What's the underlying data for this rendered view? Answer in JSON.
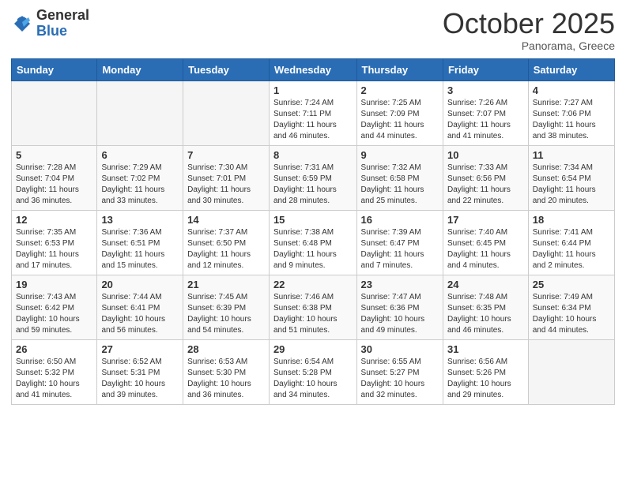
{
  "header": {
    "logo_general": "General",
    "logo_blue": "Blue",
    "month_title": "October 2025",
    "subtitle": "Panorama, Greece"
  },
  "days_of_week": [
    "Sunday",
    "Monday",
    "Tuesday",
    "Wednesday",
    "Thursday",
    "Friday",
    "Saturday"
  ],
  "weeks": [
    [
      {
        "day": "",
        "info": ""
      },
      {
        "day": "",
        "info": ""
      },
      {
        "day": "",
        "info": ""
      },
      {
        "day": "1",
        "info": "Sunrise: 7:24 AM\nSunset: 7:11 PM\nDaylight: 11 hours\nand 46 minutes."
      },
      {
        "day": "2",
        "info": "Sunrise: 7:25 AM\nSunset: 7:09 PM\nDaylight: 11 hours\nand 44 minutes."
      },
      {
        "day": "3",
        "info": "Sunrise: 7:26 AM\nSunset: 7:07 PM\nDaylight: 11 hours\nand 41 minutes."
      },
      {
        "day": "4",
        "info": "Sunrise: 7:27 AM\nSunset: 7:06 PM\nDaylight: 11 hours\nand 38 minutes."
      }
    ],
    [
      {
        "day": "5",
        "info": "Sunrise: 7:28 AM\nSunset: 7:04 PM\nDaylight: 11 hours\nand 36 minutes."
      },
      {
        "day": "6",
        "info": "Sunrise: 7:29 AM\nSunset: 7:02 PM\nDaylight: 11 hours\nand 33 minutes."
      },
      {
        "day": "7",
        "info": "Sunrise: 7:30 AM\nSunset: 7:01 PM\nDaylight: 11 hours\nand 30 minutes."
      },
      {
        "day": "8",
        "info": "Sunrise: 7:31 AM\nSunset: 6:59 PM\nDaylight: 11 hours\nand 28 minutes."
      },
      {
        "day": "9",
        "info": "Sunrise: 7:32 AM\nSunset: 6:58 PM\nDaylight: 11 hours\nand 25 minutes."
      },
      {
        "day": "10",
        "info": "Sunrise: 7:33 AM\nSunset: 6:56 PM\nDaylight: 11 hours\nand 22 minutes."
      },
      {
        "day": "11",
        "info": "Sunrise: 7:34 AM\nSunset: 6:54 PM\nDaylight: 11 hours\nand 20 minutes."
      }
    ],
    [
      {
        "day": "12",
        "info": "Sunrise: 7:35 AM\nSunset: 6:53 PM\nDaylight: 11 hours\nand 17 minutes."
      },
      {
        "day": "13",
        "info": "Sunrise: 7:36 AM\nSunset: 6:51 PM\nDaylight: 11 hours\nand 15 minutes."
      },
      {
        "day": "14",
        "info": "Sunrise: 7:37 AM\nSunset: 6:50 PM\nDaylight: 11 hours\nand 12 minutes."
      },
      {
        "day": "15",
        "info": "Sunrise: 7:38 AM\nSunset: 6:48 PM\nDaylight: 11 hours\nand 9 minutes."
      },
      {
        "day": "16",
        "info": "Sunrise: 7:39 AM\nSunset: 6:47 PM\nDaylight: 11 hours\nand 7 minutes."
      },
      {
        "day": "17",
        "info": "Sunrise: 7:40 AM\nSunset: 6:45 PM\nDaylight: 11 hours\nand 4 minutes."
      },
      {
        "day": "18",
        "info": "Sunrise: 7:41 AM\nSunset: 6:44 PM\nDaylight: 11 hours\nand 2 minutes."
      }
    ],
    [
      {
        "day": "19",
        "info": "Sunrise: 7:43 AM\nSunset: 6:42 PM\nDaylight: 10 hours\nand 59 minutes."
      },
      {
        "day": "20",
        "info": "Sunrise: 7:44 AM\nSunset: 6:41 PM\nDaylight: 10 hours\nand 56 minutes."
      },
      {
        "day": "21",
        "info": "Sunrise: 7:45 AM\nSunset: 6:39 PM\nDaylight: 10 hours\nand 54 minutes."
      },
      {
        "day": "22",
        "info": "Sunrise: 7:46 AM\nSunset: 6:38 PM\nDaylight: 10 hours\nand 51 minutes."
      },
      {
        "day": "23",
        "info": "Sunrise: 7:47 AM\nSunset: 6:36 PM\nDaylight: 10 hours\nand 49 minutes."
      },
      {
        "day": "24",
        "info": "Sunrise: 7:48 AM\nSunset: 6:35 PM\nDaylight: 10 hours\nand 46 minutes."
      },
      {
        "day": "25",
        "info": "Sunrise: 7:49 AM\nSunset: 6:34 PM\nDaylight: 10 hours\nand 44 minutes."
      }
    ],
    [
      {
        "day": "26",
        "info": "Sunrise: 6:50 AM\nSunset: 5:32 PM\nDaylight: 10 hours\nand 41 minutes."
      },
      {
        "day": "27",
        "info": "Sunrise: 6:52 AM\nSunset: 5:31 PM\nDaylight: 10 hours\nand 39 minutes."
      },
      {
        "day": "28",
        "info": "Sunrise: 6:53 AM\nSunset: 5:30 PM\nDaylight: 10 hours\nand 36 minutes."
      },
      {
        "day": "29",
        "info": "Sunrise: 6:54 AM\nSunset: 5:28 PM\nDaylight: 10 hours\nand 34 minutes."
      },
      {
        "day": "30",
        "info": "Sunrise: 6:55 AM\nSunset: 5:27 PM\nDaylight: 10 hours\nand 32 minutes."
      },
      {
        "day": "31",
        "info": "Sunrise: 6:56 AM\nSunset: 5:26 PM\nDaylight: 10 hours\nand 29 minutes."
      },
      {
        "day": "",
        "info": ""
      }
    ]
  ]
}
